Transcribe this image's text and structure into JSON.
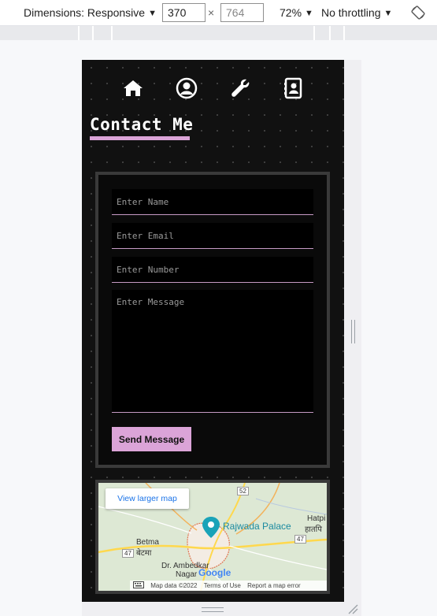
{
  "devtools": {
    "dimensions_label": "Dimensions: Responsive",
    "width": "370",
    "height": "764",
    "times": "×",
    "zoom": "72%",
    "throttling": "No throttling",
    "caret": "▼"
  },
  "page": {
    "title": "Contact Me",
    "accent_color": "#dba4d8",
    "nav": [
      "home-icon",
      "user-circle-icon",
      "wrench-icon",
      "contact-book-icon"
    ]
  },
  "form": {
    "name_placeholder": "Enter Name",
    "email_placeholder": "Enter Email",
    "number_placeholder": "Enter Number",
    "message_placeholder": "Enter Message",
    "submit_label": "Send Message"
  },
  "map": {
    "view_larger_label": "View larger map",
    "place_name": "Rajwada Palace",
    "label_hatpi": "Hatpi",
    "label_hatpi_hindi": "हातपि",
    "label_betma": "Betma",
    "label_betma_hindi": "बेटमा",
    "label_ambedkar": "Dr. Ambedkar",
    "label_nagar": "Nagar",
    "road_52": "52",
    "road_47_left": "47",
    "road_47_right": "47",
    "google": "Google",
    "keyboard_icon": "keyboard-icon",
    "map_data": "Map data ©2022",
    "terms": "Terms of Use",
    "report": "Report a map error"
  }
}
